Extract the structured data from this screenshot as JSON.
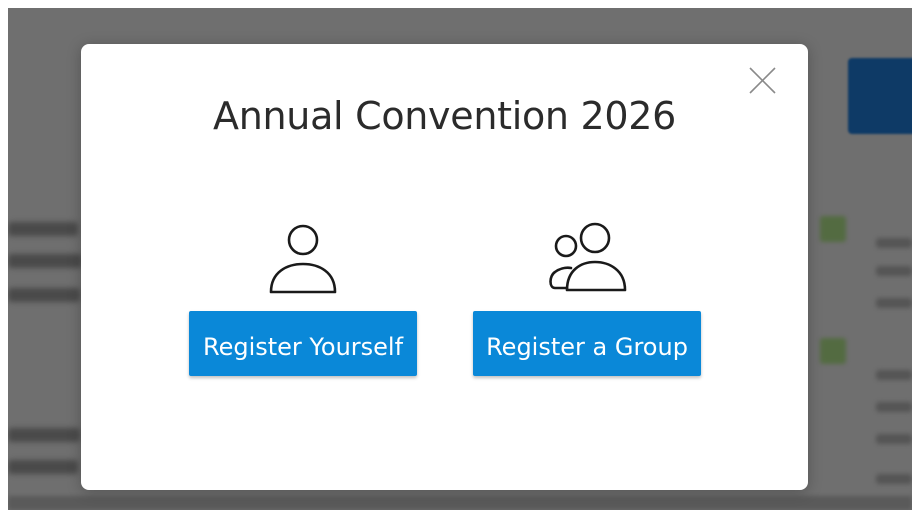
{
  "modal": {
    "title": "Annual Convention 2026",
    "close_icon": "close-icon",
    "options": [
      {
        "icon": "person-icon",
        "button_label": "Register Yourself"
      },
      {
        "icon": "group-icon",
        "button_label": "Register a Group"
      }
    ]
  },
  "colors": {
    "button_blue": "#0a88d8",
    "overlay_gray": "#6f6f6f",
    "title_text": "#2b2b2b"
  }
}
